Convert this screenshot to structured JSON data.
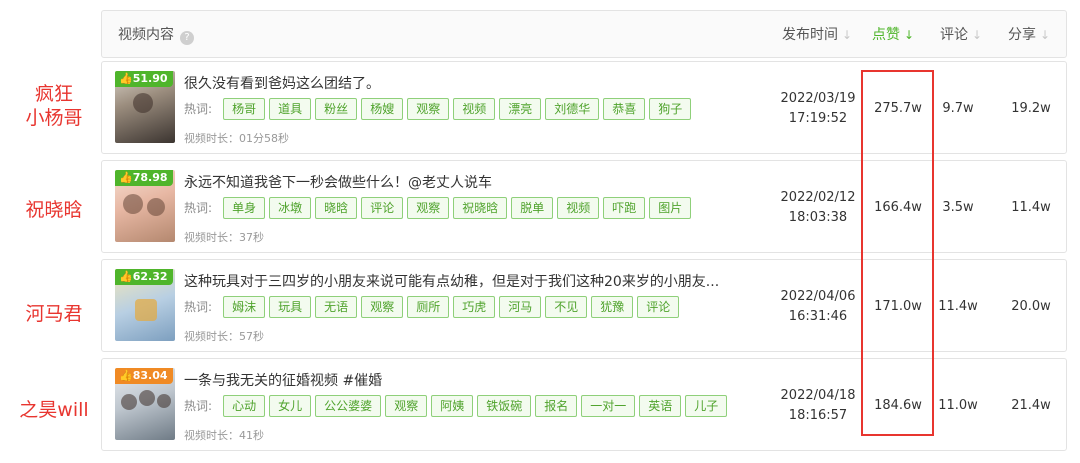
{
  "header": {
    "content_label": "视频内容",
    "help_icon": "?",
    "publish_time_label": "发布时间",
    "likes_label": "点赞",
    "comments_label": "评论",
    "shares_label": "分享",
    "sort_arrow": "↓"
  },
  "tags_label": "热词:",
  "side_labels": [
    "疯狂\n小杨哥",
    "祝晓晗",
    "河马君",
    "之昊will"
  ],
  "rows": [
    {
      "badge": "51.90",
      "badge_color": "#4fb52b",
      "title": "很久没有看到爸妈这么团结了。",
      "tags": [
        "杨哥",
        "道具",
        "粉丝",
        "杨嫂",
        "观察",
        "视频",
        "漂亮",
        "刘德华",
        "恭喜",
        "狗子"
      ],
      "duration": "视频时长：01分58秒",
      "date": "2022/03/19",
      "time": "17:19:52",
      "likes": "275.7w",
      "comments": "9.7w",
      "shares": "19.2w"
    },
    {
      "badge": "78.98",
      "badge_color": "#4fb52b",
      "title": "永远不知道我爸下一秒会做些什么！@老丈人说车",
      "tags": [
        "单身",
        "冰墩",
        "晓晗",
        "评论",
        "观察",
        "祝晓晗",
        "脱单",
        "视频",
        "吓跑",
        "图片"
      ],
      "duration": "视频时长：37秒",
      "date": "2022/02/12",
      "time": "18:03:38",
      "likes": "166.4w",
      "comments": "3.5w",
      "shares": "11.4w"
    },
    {
      "badge": "62.32",
      "badge_color": "#4fb52b",
      "title": "这种玩具对于三四岁的小朋友来说可能有点幼稚，但是对于我们这种20来岁的小朋友...",
      "tags": [
        "姆沫",
        "玩具",
        "无语",
        "观察",
        "厕所",
        "巧虎",
        "河马",
        "不见",
        "犹豫",
        "评论"
      ],
      "duration": "视频时长：57秒",
      "date": "2022/04/06",
      "time": "16:31:46",
      "likes": "171.0w",
      "comments": "11.4w",
      "shares": "20.0w"
    },
    {
      "badge": "83.04",
      "badge_color": "#f08a24",
      "title": "一条与我无关的征婚视频 #催婚",
      "tags": [
        "心动",
        "女儿",
        "公公婆婆",
        "观察",
        "阿姨",
        "铁饭碗",
        "报名",
        "一对一",
        "英语",
        "儿子"
      ],
      "duration": "视频时长：41秒",
      "date": "2022/04/18",
      "time": "18:16:57",
      "likes": "184.6w",
      "comments": "11.0w",
      "shares": "21.4w"
    }
  ],
  "colors": {
    "accent_green": "#4fb52b",
    "highlight_red": "#e8352f",
    "badge_orange": "#f08a24"
  }
}
